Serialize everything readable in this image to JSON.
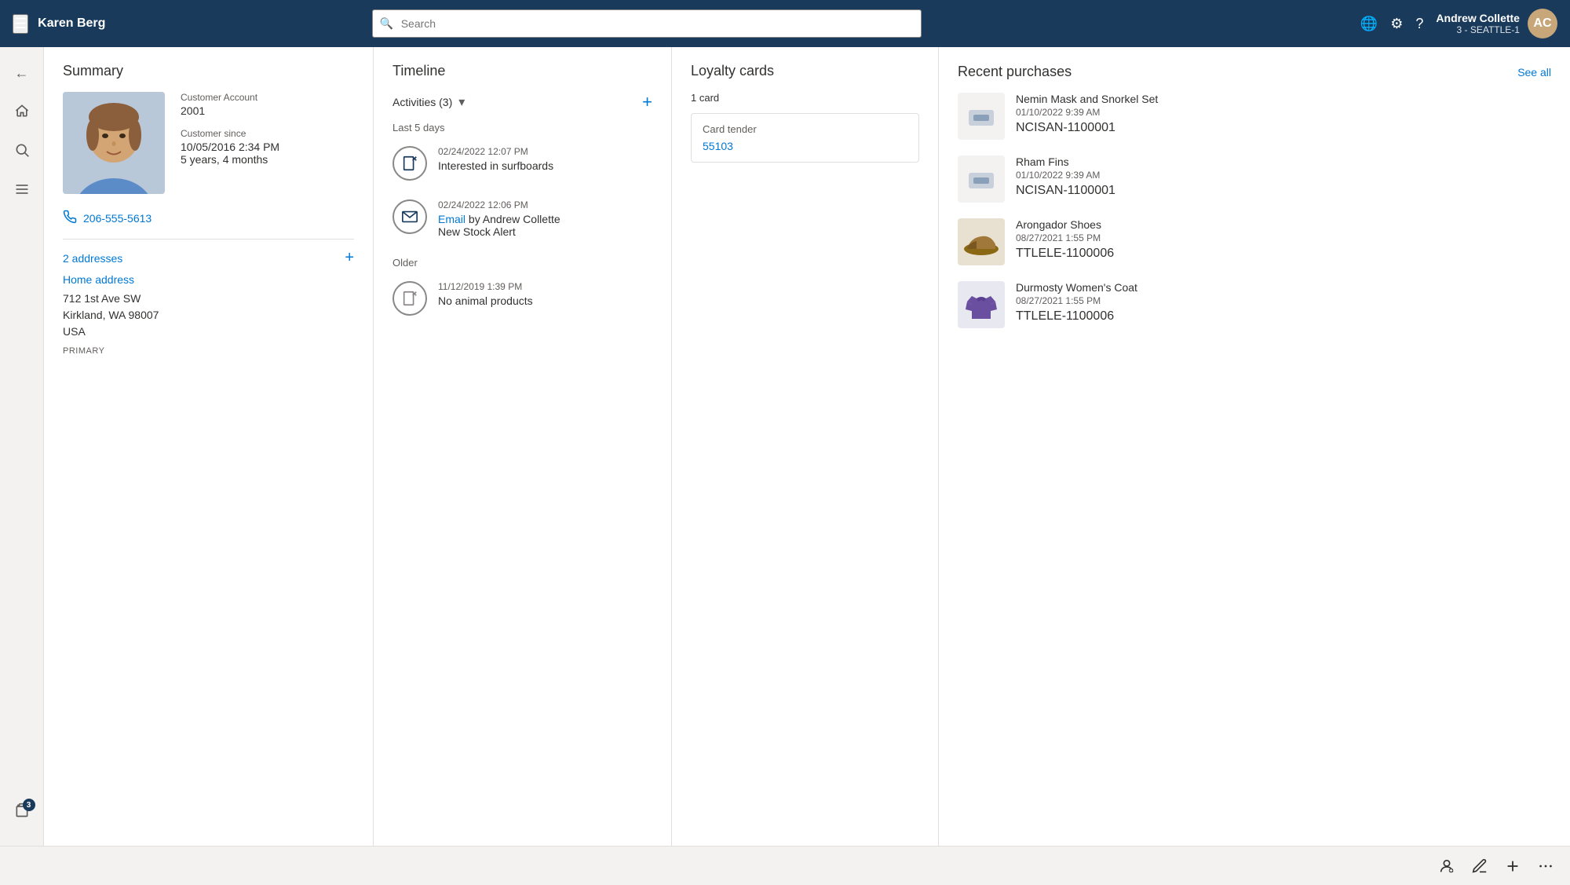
{
  "topNav": {
    "hamburger_label": "☰",
    "title": "Karen Berg",
    "search_placeholder": "Search",
    "user": {
      "name": "Andrew Collette",
      "sub": "3 - SEATTLE-1",
      "avatar_initials": "AC"
    },
    "icons": {
      "globe": "🌐",
      "settings": "⚙",
      "help": "?"
    }
  },
  "sidebar": {
    "items": [
      {
        "name": "back",
        "icon": "←"
      },
      {
        "name": "home",
        "icon": "⌂"
      },
      {
        "name": "search",
        "icon": "🔍"
      },
      {
        "name": "menu",
        "icon": "≡"
      },
      {
        "name": "clipboard",
        "icon": "📋",
        "badge": "3"
      }
    ]
  },
  "summary": {
    "title": "Summary",
    "customer_account_label": "Customer Account",
    "customer_account_value": "2001",
    "customer_since_label": "Customer since",
    "customer_since_value": "10/05/2016 2:34 PM",
    "customer_since_duration": "5 years, 4 months",
    "phone": "206-555-5613",
    "addresses_link": "2 addresses",
    "home_address_label": "Home address",
    "address_line1": "712 1st Ave SW",
    "address_line2": "Kirkland, WA 98007",
    "address_line3": "USA",
    "primary_badge": "PRIMARY"
  },
  "timeline": {
    "title": "Timeline",
    "activities_label": "Activities (3)",
    "add_button_label": "+",
    "period_recent": "Last 5 days",
    "items_recent": [
      {
        "time": "02/24/2022 12:07 PM",
        "text": "Interested in surfboards",
        "icon_type": "note"
      },
      {
        "time": "02/24/2022 12:06 PM",
        "text_prefix": "Email",
        "text_by": " by Andrew Collette",
        "text_body": "New Stock Alert",
        "icon_type": "email"
      }
    ],
    "period_older": "Older",
    "items_older": [
      {
        "time": "11/12/2019 1:39 PM",
        "text": "No animal products",
        "icon_type": "note"
      }
    ]
  },
  "loyalty": {
    "title": "Loyalty cards",
    "count": "1 card",
    "card_tender_label": "Card tender",
    "card_tender_value": "55103"
  },
  "purchases": {
    "title": "Recent purchases",
    "see_all": "See all",
    "items": [
      {
        "name": "Nemin Mask and Snorkel Set",
        "date": "01/10/2022 9:39 AM",
        "id": "NCISAN-1100001",
        "thumb_type": "box"
      },
      {
        "name": "Rham Fins",
        "date": "01/10/2022 9:39 AM",
        "id": "NCISAN-1100001",
        "thumb_type": "box"
      },
      {
        "name": "Arongador Shoes",
        "date": "08/27/2021 1:55 PM",
        "id": "TTLELE-1100006",
        "thumb_type": "shoe"
      },
      {
        "name": "Durmosty Women's Coat",
        "date": "08/27/2021 1:55 PM",
        "id": "TTLELE-1100006",
        "thumb_type": "coat"
      }
    ]
  },
  "bottomBar": {
    "person_icon": "👤",
    "edit_icon": "✏",
    "add_icon": "+",
    "more_icon": "···"
  }
}
